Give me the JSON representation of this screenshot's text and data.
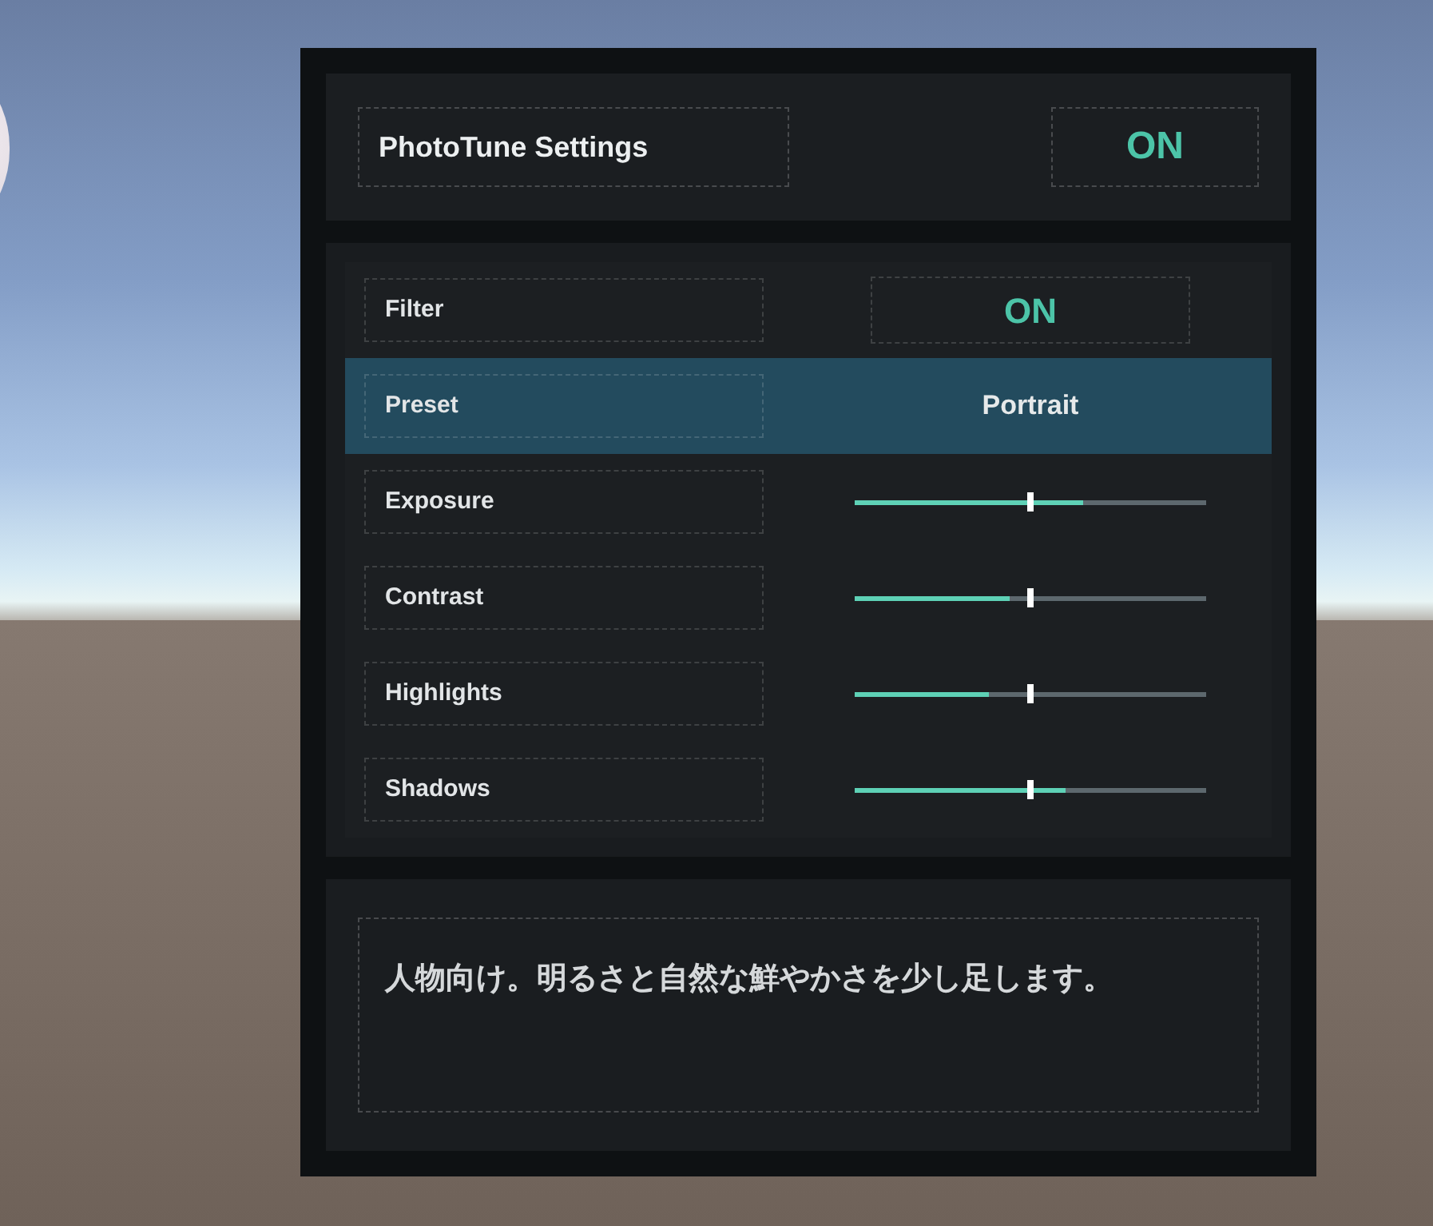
{
  "header": {
    "title": "PhotoTune Settings",
    "value": "ON"
  },
  "rows": [
    {
      "kind": "toggle",
      "label": "Filter",
      "value": "ON",
      "selected": false
    },
    {
      "kind": "choice",
      "label": "Preset",
      "value": "Portrait",
      "selected": true
    },
    {
      "kind": "slider",
      "label": "Exposure",
      "level": 0.65,
      "selected": false
    },
    {
      "kind": "slider",
      "label": "Contrast",
      "level": 0.44,
      "selected": false
    },
    {
      "kind": "slider",
      "label": "Highlights",
      "level": 0.38,
      "selected": false
    },
    {
      "kind": "slider",
      "label": "Shadows",
      "level": 0.6,
      "selected": false
    }
  ],
  "description": "人物向け。明るさと自然な鮮やかさを少し足します。"
}
